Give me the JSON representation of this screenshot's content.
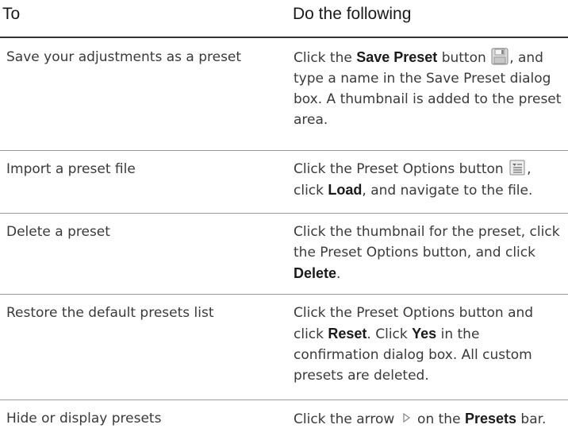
{
  "header": {
    "col1": "To",
    "col2": "Do the following"
  },
  "rows": [
    {
      "task": "Save your adjustments as a preset",
      "p1": "Click the ",
      "b1": "Save Preset",
      "p2": " button ",
      "p3": ", and type a name in the Save Preset dialog box. A thumbnail is added to the preset area."
    },
    {
      "task": "Import a preset file",
      "p1": "Click the Preset Options button ",
      "p2": ", click ",
      "b1": "Load",
      "p3": ", and navigate to the file."
    },
    {
      "task": "Delete a preset",
      "p1": "Click the thumbnail for the preset, click the Preset Options button, and click ",
      "b1": "Delete",
      "p2": "."
    },
    {
      "task": "Restore the default presets list",
      "p1": "Click the Preset Options button and click ",
      "b1": "Reset",
      "p2": ". Click ",
      "b2": "Yes",
      "p3": " in the confirmation dialog box. All custom presets are deleted."
    },
    {
      "task": "Hide or display presets",
      "p1": "Click the arrow ",
      "p2": " on the ",
      "b1": "Presets",
      "p3": " bar."
    }
  ],
  "icons": {
    "save": "floppy-disk-icon",
    "options": "preset-options-icon",
    "arrow": "right-arrow-icon"
  }
}
